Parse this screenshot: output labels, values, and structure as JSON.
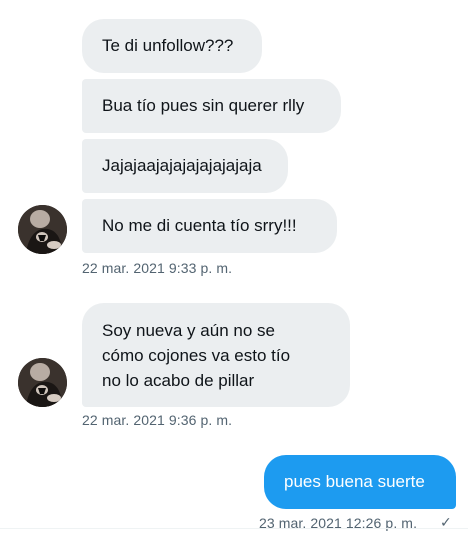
{
  "conversation": {
    "group1": {
      "messages": [
        "Te di unfollow???",
        "Bua tío pues sin querer rlly",
        "Jajajaajajajajajajajaja",
        "No me di cuenta tío srry!!!"
      ],
      "timestamp": "22 mar. 2021 9:33 p. m."
    },
    "group2": {
      "message_line1": "Soy nueva y aún no se",
      "message_line2": "cómo cojones va esto tío",
      "message_line3": "no lo acabo de pillar",
      "timestamp": "22 mar. 2021 9:36 p. m."
    },
    "outgoing": {
      "message": "pues buena suerte",
      "timestamp": "23 mar. 2021 12:26 p. m.",
      "status_icon": "check-icon"
    }
  },
  "colors": {
    "incoming_bubble": "#ebeef0",
    "outgoing_bubble": "#1d9bf0",
    "meta_text": "#536471"
  }
}
